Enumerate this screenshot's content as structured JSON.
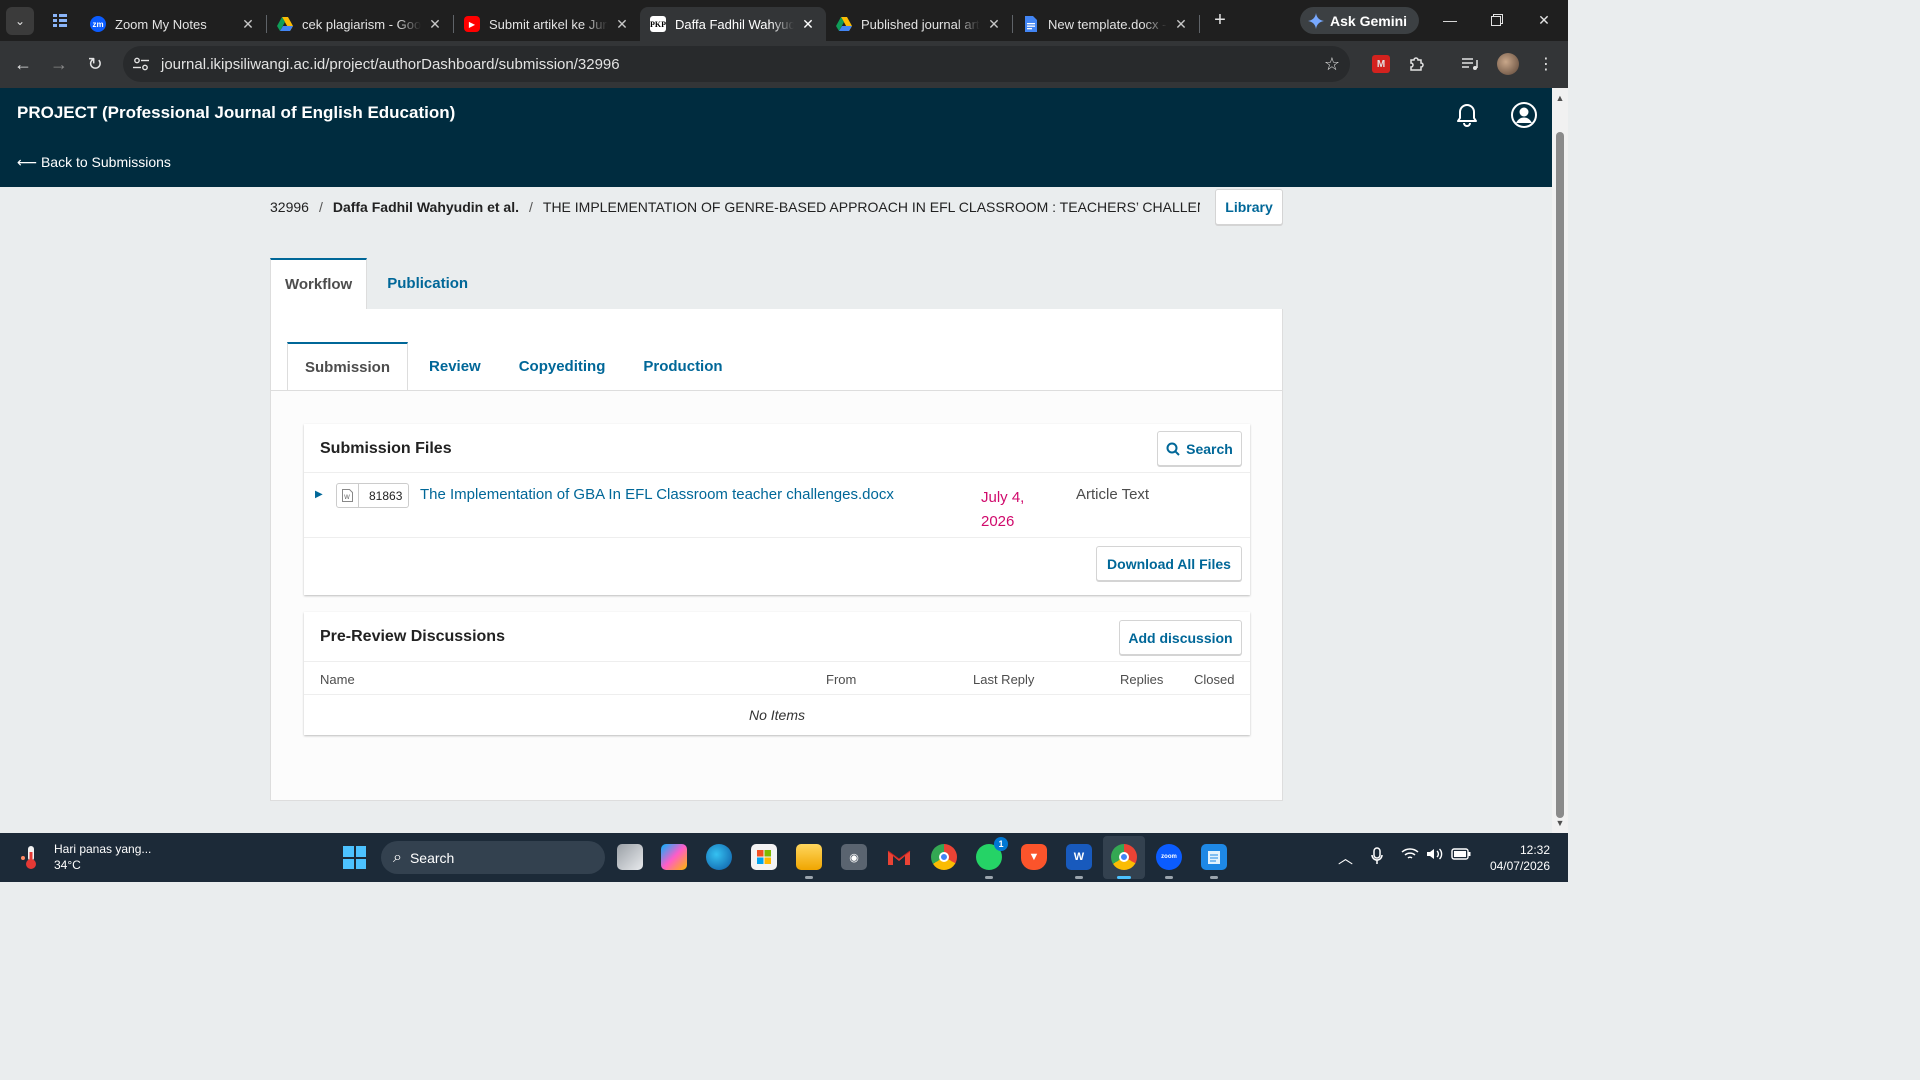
{
  "browser": {
    "tabs": [
      {
        "title": "Zoom My Notes",
        "favicon_text": "zm",
        "favicon_color": "#0b5cff"
      },
      {
        "title": "cek plagiarism - Goo",
        "favicon_text": "",
        "favicon_color": "#fbbc04"
      },
      {
        "title": "Submit artikel ke Jurn",
        "favicon_text": "▶",
        "favicon_color": "#ff0000"
      },
      {
        "title": "Daffa Fadhil Wahyudi",
        "favicon_text": "PKP",
        "favicon_color": "#ffffff"
      },
      {
        "title": "Published journal artic",
        "favicon_text": "",
        "favicon_color": "#fbbc04"
      },
      {
        "title": "New template.docx -",
        "favicon_text": "",
        "favicon_color": "#4285f4"
      }
    ],
    "tab_close": "✕",
    "ask_gemini": "Ask Gemini",
    "url": "journal.ikipsiliwangi.ac.id/project/authorDashboard/submission/32996"
  },
  "header": {
    "journal_name": "PROJECT (Professional Journal of English Education)",
    "back_link": "⟵ Back to Submissions"
  },
  "breadcrumb": {
    "id": "32996",
    "authors": "Daffa Fadhil Wahyudin et al.",
    "title": "THE IMPLEMENTATION OF GENRE-BASED APPROACH IN EFL CLASSROOM : TEACHERS’ CHALLENGES",
    "separator": "/"
  },
  "library_button": "Library",
  "main_tabs": [
    {
      "label": "Workflow",
      "active": true
    },
    {
      "label": "Publication",
      "active": false
    }
  ],
  "workflow_tabs": [
    {
      "label": "Submission",
      "active": true
    },
    {
      "label": "Review",
      "active": false
    },
    {
      "label": "Copyediting",
      "active": false
    },
    {
      "label": "Production",
      "active": false
    }
  ],
  "submission_files": {
    "title": "Submission Files",
    "search_button": "Search",
    "files": [
      {
        "id": "81863",
        "name": "The Implementation of GBA In EFL Classroom teacher challenges.docx",
        "date": "July 4, 2026",
        "type": "Article Text"
      }
    ],
    "download_all_button": "Download All Files"
  },
  "discussions": {
    "title": "Pre-Review Discussions",
    "add_button": "Add discussion",
    "columns": [
      "Name",
      "From",
      "Last Reply",
      "Replies",
      "Closed"
    ],
    "empty_text": "No Items"
  },
  "taskbar": {
    "weather_text": "Hari panas yang...",
    "temperature": "34°C",
    "search_placeholder": "Search",
    "whatsapp_badge": "1",
    "time": "12:32",
    "date": "04/07/2026"
  },
  "colors": {
    "ojs_header": "#002c3f",
    "link_blue": "#006798",
    "date_magenta": "#d00a6c",
    "tab_bar": "#1f1f1f",
    "taskbar": "#1c2a38"
  }
}
